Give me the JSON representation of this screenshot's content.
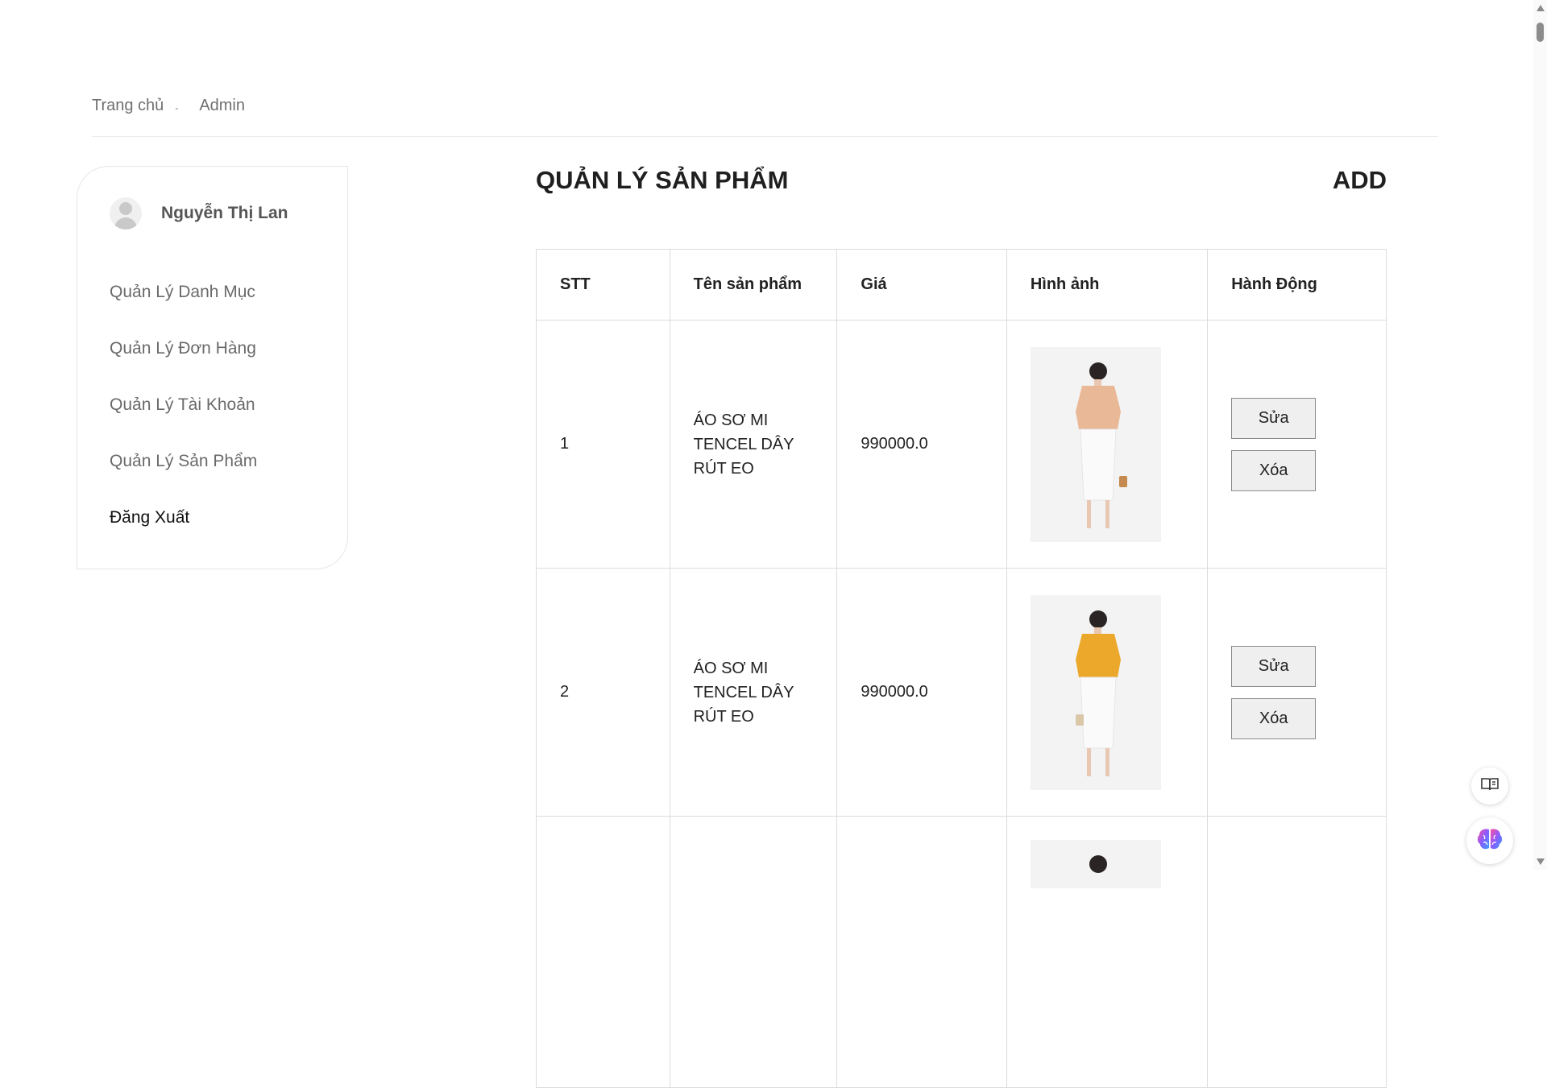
{
  "breadcrumb": {
    "home": "Trang chủ",
    "separator": "-",
    "current": "Admin"
  },
  "sidebar": {
    "user_name": "Nguyễn Thị Lan",
    "menu": [
      {
        "label": "Quản Lý Danh Mục"
      },
      {
        "label": "Quản Lý Đơn Hàng"
      },
      {
        "label": "Quản Lý Tài Khoản"
      },
      {
        "label": "Quản Lý Sản Phẩm"
      },
      {
        "label": "Đăng Xuất"
      }
    ]
  },
  "main": {
    "title": "QUẢN LÝ SẢN PHẨM",
    "add_label": "ADD",
    "table": {
      "headers": [
        "STT",
        "Tên sản phẩm",
        "Giá",
        "Hình ảnh",
        "Hành Động"
      ],
      "rows": [
        {
          "stt": "1",
          "name": "ÁO SƠ MI TENCEL DÂY RÚT EO",
          "price": "990000.0",
          "image_color": "#e9b896"
        },
        {
          "stt": "2",
          "name": "ÁO SƠ MI TENCEL DÂY RÚT EO",
          "price": "990000.0",
          "image_color": "#eba82a"
        }
      ],
      "edit_label": "Sửa",
      "delete_label": "Xóa"
    }
  },
  "icons": {
    "reader": "book-icon",
    "assistant": "brain-icon"
  }
}
